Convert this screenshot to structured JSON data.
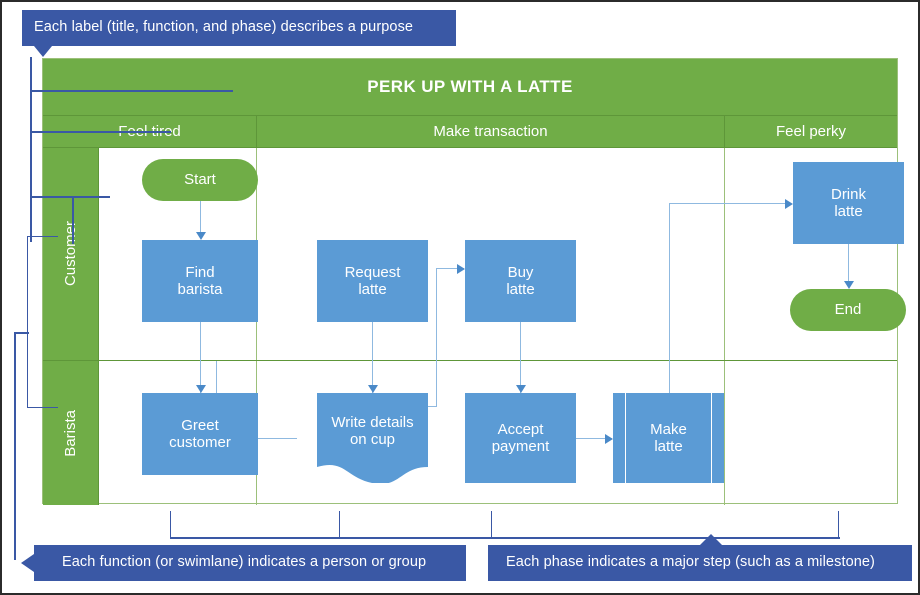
{
  "callouts": {
    "top": "Each label (title, function,  and phase) describes a purpose",
    "bottom_left": "Each function  (or swimlane) indicates  a person or group",
    "bottom_right": "Each phase indicates  a major step (such as a milestone)"
  },
  "diagram": {
    "title": "PERK UP WITH A LATTE",
    "phases": [
      {
        "label": "Feel tired"
      },
      {
        "label": "Make transaction"
      },
      {
        "label": "Feel perky"
      }
    ],
    "lanes": [
      {
        "label": "Customer"
      },
      {
        "label": "Barista"
      }
    ],
    "shapes": [
      {
        "id": "start",
        "label": "Start",
        "type": "terminator",
        "lane": "Customer",
        "phase": "Feel tired"
      },
      {
        "id": "find-barista",
        "label": "Find\nbarista",
        "type": "process",
        "lane": "Customer",
        "phase": "Feel tired"
      },
      {
        "id": "request-latte",
        "label": "Request\nlatte",
        "type": "process",
        "lane": "Customer",
        "phase": "Make transaction"
      },
      {
        "id": "buy-latte",
        "label": "Buy\nlatte",
        "type": "process",
        "lane": "Customer",
        "phase": "Make transaction"
      },
      {
        "id": "drink-latte",
        "label": "Drink\nlatte",
        "type": "process",
        "lane": "Customer",
        "phase": "Feel perky"
      },
      {
        "id": "end",
        "label": "End",
        "type": "terminator",
        "lane": "Customer",
        "phase": "Feel perky"
      },
      {
        "id": "greet-customer",
        "label": "Greet\ncustomer",
        "type": "process",
        "lane": "Barista",
        "phase": "Feel tired"
      },
      {
        "id": "write-details",
        "label": "Write details\non cup",
        "type": "document",
        "lane": "Barista",
        "phase": "Make transaction"
      },
      {
        "id": "accept-payment",
        "label": "Accept\npayment",
        "type": "process",
        "lane": "Barista",
        "phase": "Make transaction"
      },
      {
        "id": "make-latte",
        "label": "Make\nlatte",
        "type": "predefined-process",
        "lane": "Barista",
        "phase": "Make transaction"
      }
    ]
  },
  "colors": {
    "green": "#70ad47",
    "green_border": "#5e9639",
    "blue": "#5b9bd5",
    "connector": "#8fb9e0",
    "callout": "#3a58a5",
    "frame_border": "#9cc07a",
    "page_border": "#2b2b2b",
    "text_on_fill": "#ffffff"
  }
}
